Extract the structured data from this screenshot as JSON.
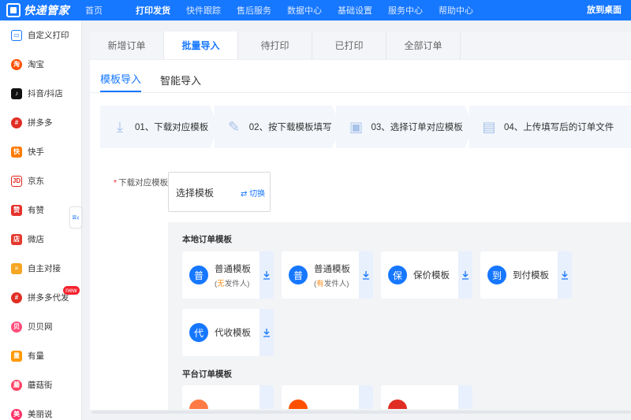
{
  "app": {
    "name": "快递管家"
  },
  "topnav": {
    "items": [
      "首页",
      "打印发货",
      "快件跟踪",
      "售后服务",
      "数据中心",
      "基础设置",
      "服务中心",
      "帮助中心"
    ],
    "active_index": 1,
    "right_link": "放到桌面"
  },
  "sidebar": {
    "items": [
      {
        "label": "自定义打印",
        "icon": "printer-icon",
        "color": "#1677ff"
      },
      {
        "label": "淘宝",
        "icon": "taobao-icon",
        "color": "#ff5000"
      },
      {
        "label": "抖音/抖店",
        "icon": "douyin-icon",
        "color": "#111111"
      },
      {
        "label": "拼多多",
        "icon": "pinduoduo-icon",
        "color": "#e02e24"
      },
      {
        "label": "快手",
        "icon": "kuaishou-icon",
        "color": "#ff7a00"
      },
      {
        "label": "京东",
        "icon": "jd-icon",
        "color": "#e1251b"
      },
      {
        "label": "有赞",
        "icon": "youzan-icon",
        "color": "#e5322d"
      },
      {
        "label": "微店",
        "icon": "weidian-icon",
        "color": "#e33a2f"
      },
      {
        "label": "自主对接",
        "icon": "api-icon",
        "color": "#f5a623"
      },
      {
        "label": "拼多多代发",
        "icon": "pinduoduo-dropship-icon",
        "color": "#e02e24",
        "badge": "new"
      },
      {
        "label": "贝贝网",
        "icon": "beibei-icon",
        "color": "#ff4d7a"
      },
      {
        "label": "有量",
        "icon": "youliang-icon",
        "color": "#ff9900"
      },
      {
        "label": "蘑菇街",
        "icon": "mogujie-icon",
        "color": "#ff4466"
      },
      {
        "label": "美丽说",
        "icon": "meilishuo-icon",
        "color": "#ff3366"
      }
    ]
  },
  "tabs": {
    "items": [
      "新增订单",
      "批量导入",
      "待打印",
      "已打印",
      "全部订单"
    ],
    "active_index": 1
  },
  "subtabs": {
    "items": [
      "模板导入",
      "智能导入"
    ],
    "active_index": 0
  },
  "steps": [
    {
      "label": "01、下载对应模板",
      "icon": "download-icon"
    },
    {
      "label": "02、按下载模板填写",
      "icon": "edit-icon"
    },
    {
      "label": "03、选择订单对应模板",
      "icon": "select-template-icon"
    },
    {
      "label": "04、上传填写后的订单文件",
      "icon": "upload-file-icon"
    }
  ],
  "template_field": {
    "label": "下载对应模板",
    "value": "选择模板",
    "switch_label": "切换"
  },
  "local_templates": {
    "title": "本地订单模板",
    "cards": [
      {
        "badge": "普",
        "name": "普通模板",
        "sub_prefix": "(",
        "sub_highlight": "无",
        "sub_suffix": "发件人)"
      },
      {
        "badge": "普",
        "name": "普通模板",
        "sub_prefix": "(",
        "sub_highlight": "有",
        "sub_suffix": "发件人)"
      },
      {
        "badge": "保",
        "name": "保价模板"
      },
      {
        "badge": "到",
        "name": "到付模板"
      },
      {
        "badge": "代",
        "name": "代收模板"
      }
    ]
  },
  "platform_templates": {
    "title": "平台订单模板",
    "colors": [
      "#ff7a45",
      "#ff5000",
      "#e02e24"
    ]
  },
  "colors": {
    "primary": "#1677ff",
    "highlight": "#fa8c16"
  }
}
